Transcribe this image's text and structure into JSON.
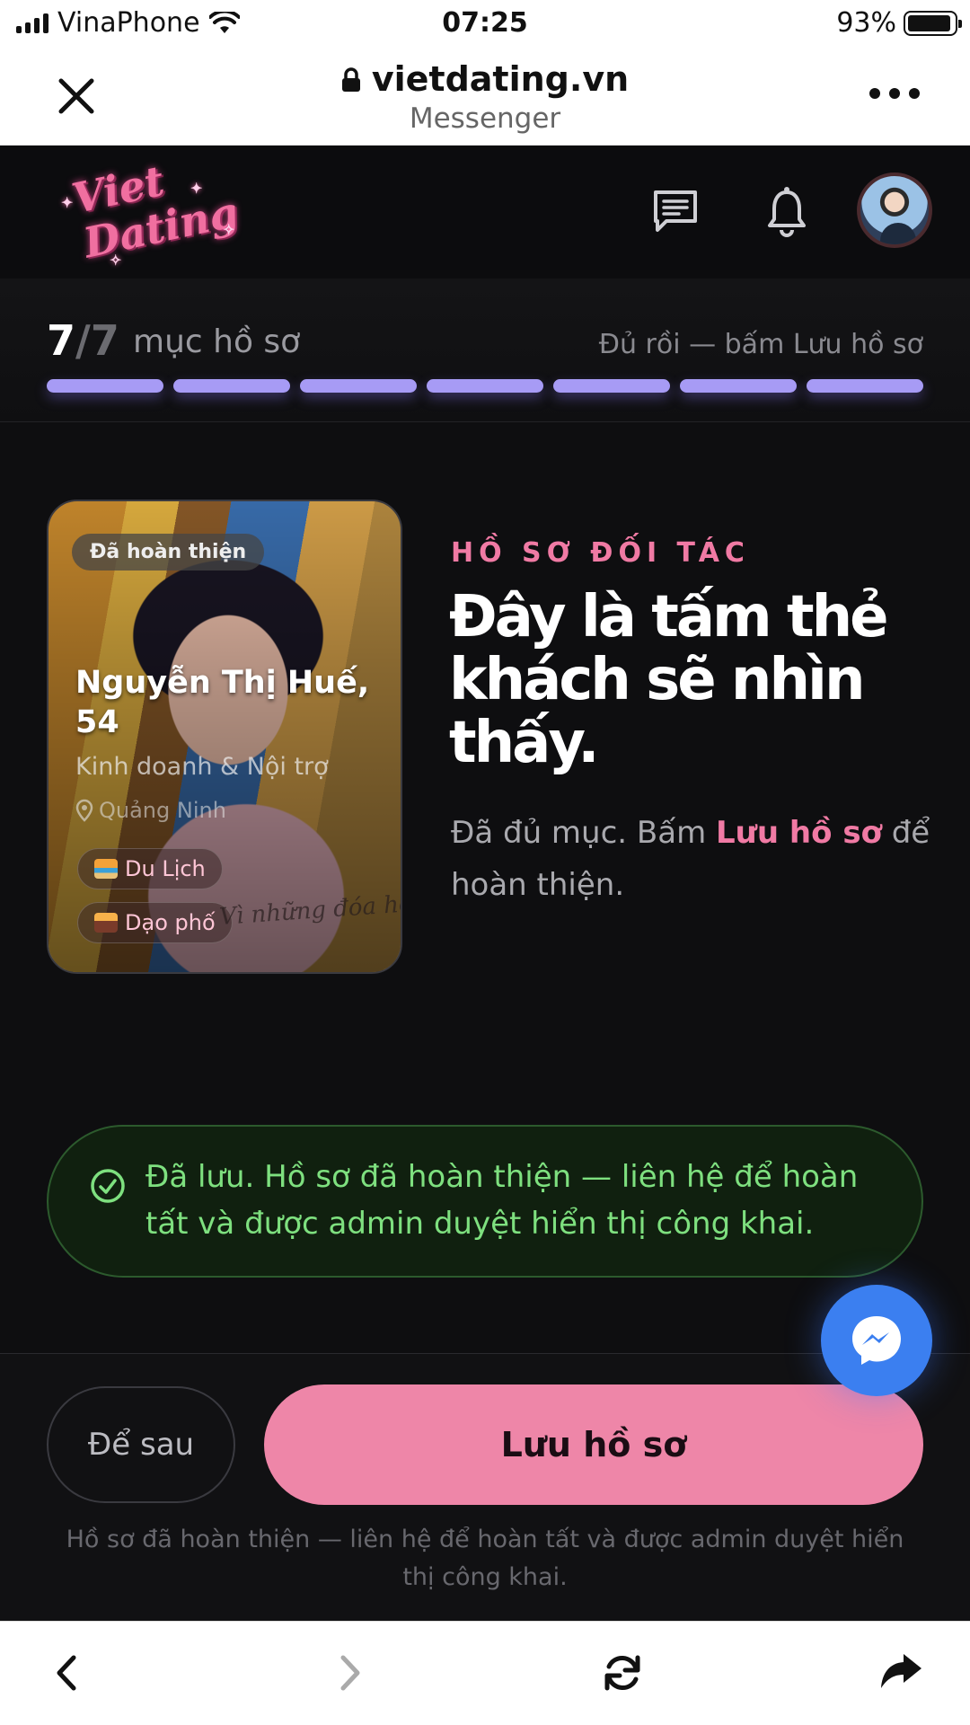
{
  "status_bar": {
    "carrier": "VinaPhone",
    "time": "07:25",
    "battery": "93%",
    "battery_level": 0.93,
    "icons": [
      "signal-icon",
      "wifi-icon",
      "battery-icon"
    ]
  },
  "browser": {
    "domain": "vietdating.vn",
    "subtitle": "Messenger",
    "icons": [
      "close-icon",
      "lock-icon",
      "more-icon"
    ]
  },
  "header": {
    "logo_line1": "Viet",
    "logo_line2": "Dating",
    "icons": [
      "chat-icon",
      "bell-icon",
      "avatar"
    ]
  },
  "progress": {
    "done": "7",
    "total": "/7",
    "label": "mục hồ sơ",
    "hint": "Đủ rồi — bấm Lưu hồ sơ",
    "segments_filled": 7,
    "segments_total": 7,
    "accent": "#a79bf5"
  },
  "card": {
    "badge": "Đã hoàn thiện",
    "name": "Nguyễn Thị Huế,",
    "age": "54",
    "job": "Kinh doanh & Nội trợ",
    "location": "Quảng Ninh",
    "tags": [
      {
        "label": "Du Lịch",
        "icon": "beach-icon"
      },
      {
        "label": "Dạo phố",
        "icon": "city-icon"
      }
    ],
    "overlay_text": "Vì những đóa hoa"
  },
  "intro": {
    "eyebrow": "HỒ SƠ ĐỐI TÁC",
    "headline": "Đây là tấm thẻ khách sẽ nhìn thấy.",
    "desc_before": "Đã đủ mục. Bấm ",
    "desc_highlight": "Lưu hồ sơ",
    "desc_after": " để hoàn thiện."
  },
  "notice": {
    "text": "Đã lưu. Hồ sơ đã hoàn thiện — liên hệ để hoàn tất và được admin duyệt hiển thị công khai.",
    "icon": "check-circle-icon",
    "color": "#7ee07f"
  },
  "actions": {
    "later_label": "Để sau",
    "save_label": "Lưu hồ sơ",
    "note": "Hồ sơ đã hoàn thiện — liên hệ để hoàn tất và được admin duyệt hiển thị công khai.",
    "accent": "#ee86a8"
  },
  "fab": {
    "icon": "messenger-icon"
  },
  "toolbar": {
    "icons": [
      "back-icon",
      "forward-icon",
      "reload-icon",
      "share-icon"
    ]
  }
}
